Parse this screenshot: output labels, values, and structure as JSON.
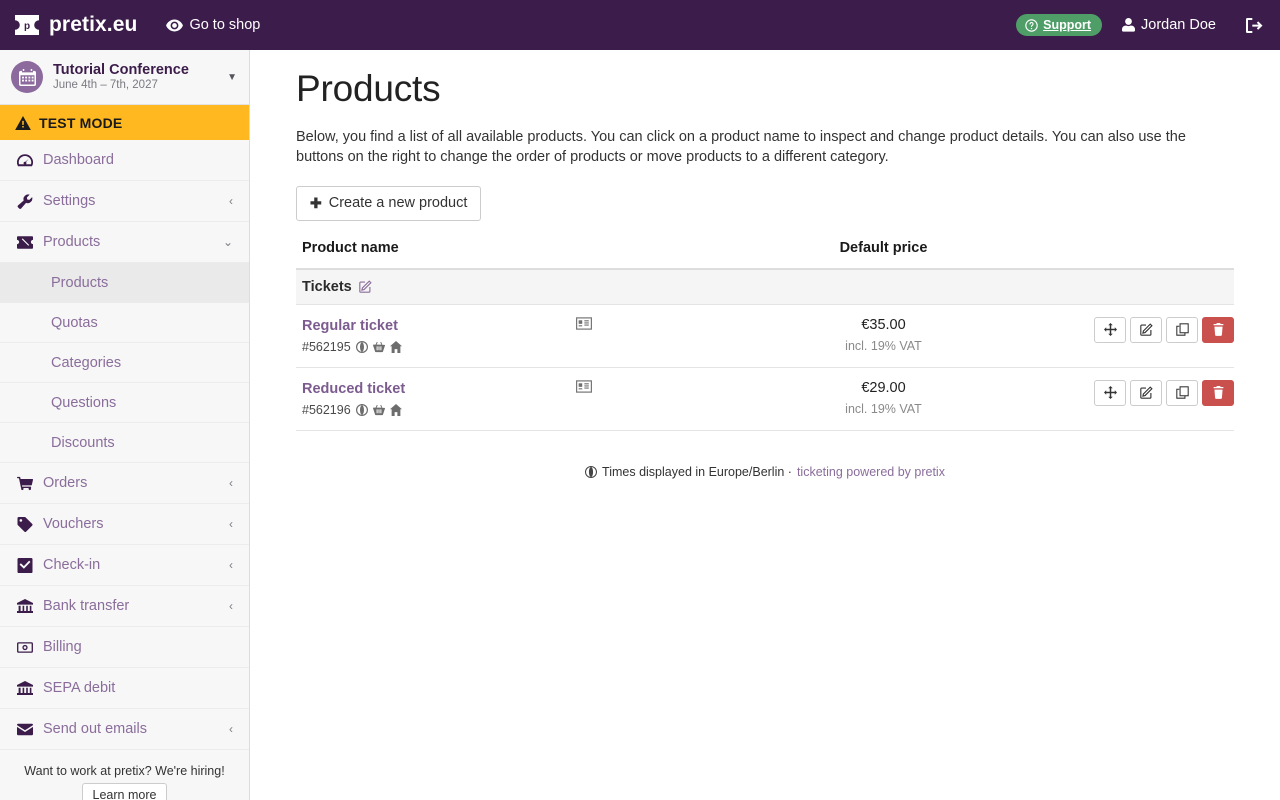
{
  "topbar": {
    "brand": "pretix.eu",
    "brand_logo_icon": "pretix-ticket-logo-icon",
    "goto_shop": "Go to shop",
    "goto_shop_icon": "eye-icon",
    "support": "Support",
    "support_icon": "question-circle-icon",
    "support_color": "#4f9e68",
    "user": "Jordan Doe",
    "user_icon": "user-icon",
    "logout_icon": "sign-out-icon",
    "background_color": "#3b1c4a"
  },
  "sidebar": {
    "event": {
      "name": "Tutorial Conference",
      "dates": "June 4th – 7th, 2027",
      "avatar_icon": "calendar-icon",
      "caret_icon": "caret-down-icon"
    },
    "test_mode": {
      "label": "TEST MODE",
      "icon": "warning-triangle-icon",
      "color": "#ffb81f"
    },
    "items": [
      {
        "label": "Dashboard",
        "icon": "dashboard-icon",
        "chevron": "",
        "active": false
      },
      {
        "label": "Settings",
        "icon": "wrench-icon",
        "chevron": "‹",
        "active": false
      },
      {
        "label": "Products",
        "icon": "ticket-icon",
        "chevron": "⌄",
        "active": false,
        "expanded": true
      }
    ],
    "products_subitems": [
      {
        "label": "Products",
        "active": true
      },
      {
        "label": "Quotas",
        "active": false
      },
      {
        "label": "Categories",
        "active": false
      },
      {
        "label": "Questions",
        "active": false
      },
      {
        "label": "Discounts",
        "active": false
      }
    ],
    "items_after": [
      {
        "label": "Orders",
        "icon": "cart-icon",
        "chevron": "‹"
      },
      {
        "label": "Vouchers",
        "icon": "tag-icon",
        "chevron": "‹"
      },
      {
        "label": "Check-in",
        "icon": "check-square-icon",
        "chevron": "‹"
      },
      {
        "label": "Bank transfer",
        "icon": "bank-icon",
        "chevron": "‹"
      },
      {
        "label": "Billing",
        "icon": "money-icon",
        "chevron": ""
      },
      {
        "label": "SEPA debit",
        "icon": "bank-icon",
        "chevron": ""
      },
      {
        "label": "Send out emails",
        "icon": "envelope-icon",
        "chevron": "‹"
      }
    ],
    "hiring": {
      "text": "Want to work at pretix? We're hiring!",
      "button": "Learn more"
    }
  },
  "main": {
    "title": "Products",
    "description": "Below, you find a list of all available products. You can click on a product name to inspect and change product details. You can also use the buttons on the right to change the order of products or move products to a different category.",
    "create_button": "Create a new product",
    "create_button_icon": "plus-icon",
    "table": {
      "headers": {
        "name": "Product name",
        "price": "Default price",
        "actions": ""
      },
      "category": {
        "label": "Tickets",
        "edit_icon": "pencil-square-icon"
      },
      "rows": [
        {
          "name": "Regular ticket",
          "id": "#562195",
          "meta_icons": [
            "globe-icon",
            "basket-icon",
            "home-icon"
          ],
          "type_icon": "id-card-icon",
          "price": "€35.00",
          "vat": "incl. 19% VAT",
          "actions": [
            {
              "name": "move",
              "icon": "arrows-move-icon",
              "style": "default"
            },
            {
              "name": "edit",
              "icon": "pencil-square-icon",
              "style": "default"
            },
            {
              "name": "duplicate",
              "icon": "copy-icon",
              "style": "default"
            },
            {
              "name": "delete",
              "icon": "trash-icon",
              "style": "danger"
            }
          ]
        },
        {
          "name": "Reduced ticket",
          "id": "#562196",
          "meta_icons": [
            "globe-icon",
            "basket-icon",
            "home-icon"
          ],
          "type_icon": "id-card-icon",
          "price": "€29.00",
          "vat": "incl. 19% VAT",
          "actions": [
            {
              "name": "move",
              "icon": "arrows-move-icon",
              "style": "default"
            },
            {
              "name": "edit",
              "icon": "pencil-square-icon",
              "style": "default"
            },
            {
              "name": "duplicate",
              "icon": "copy-icon",
              "style": "default"
            },
            {
              "name": "delete",
              "icon": "trash-icon",
              "style": "danger"
            }
          ]
        }
      ]
    },
    "footer": {
      "icon": "globe-icon",
      "times_text": "Times displayed in Europe/Berlin ·",
      "link": "ticketing powered by pretix"
    }
  }
}
